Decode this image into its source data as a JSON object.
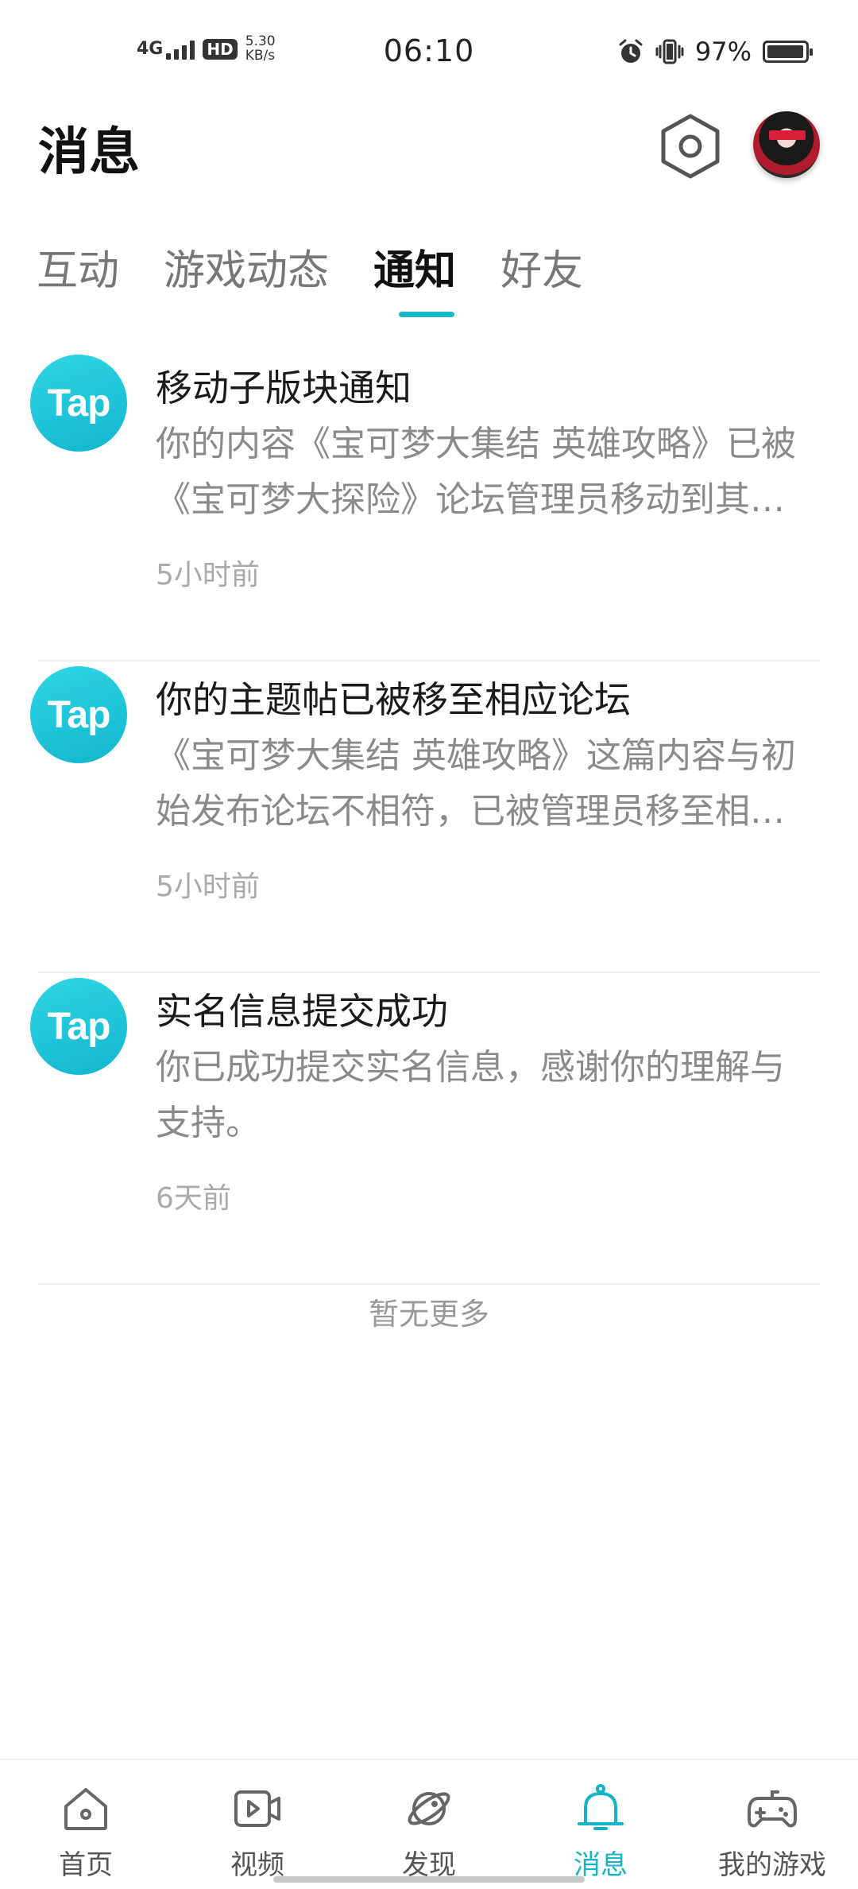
{
  "status_bar": {
    "network": "4G",
    "hd_badge": "HD",
    "speed_value": "5.30",
    "speed_unit": "KB/s",
    "time": "06:10",
    "battery_percent": "97%",
    "battery_level": 0.97,
    "icons": [
      "signal-icon",
      "alarm-icon",
      "vibrate-icon",
      "battery-icon"
    ]
  },
  "header": {
    "title": "消息",
    "settings_icon": "settings-hexagon-icon",
    "avatar": "user-avatar"
  },
  "tabs": [
    {
      "label": "互动",
      "active": false
    },
    {
      "label": "游戏动态",
      "active": false
    },
    {
      "label": "通知",
      "active": true
    },
    {
      "label": "好友",
      "active": false
    }
  ],
  "notifications": [
    {
      "logo_text": "Tap",
      "title": "移动子版块通知",
      "body": "你的内容《宝可梦大集结 英雄攻略》已被《宝可梦大探险》论坛管理员移动到其他子版块",
      "time": "5小时前"
    },
    {
      "logo_text": "Tap",
      "title": "你的主题帖已被移至相应论坛",
      "body": "《宝可梦大集结 英雄攻略》这篇内容与初始发布论坛不相符，已被管理员移至相应论坛",
      "time": "5小时前"
    },
    {
      "logo_text": "Tap",
      "title": "实名信息提交成功",
      "body": "你已成功提交实名信息，感谢你的理解与支持。",
      "time": "6天前"
    }
  ],
  "list_end_text": "暂无更多",
  "bottom_nav": [
    {
      "label": "首页",
      "icon": "home-icon",
      "active": false
    },
    {
      "label": "视频",
      "icon": "video-icon",
      "active": false
    },
    {
      "label": "发现",
      "icon": "planet-icon",
      "active": false
    },
    {
      "label": "消息",
      "icon": "bell-icon",
      "active": true
    },
    {
      "label": "我的游戏",
      "icon": "gamepad-icon",
      "active": false
    }
  ],
  "colors": {
    "accent": "#14b4c4",
    "tap_logo": "#12b6cf",
    "text_primary": "#1a1a1a",
    "text_secondary": "#8a8a8a"
  }
}
